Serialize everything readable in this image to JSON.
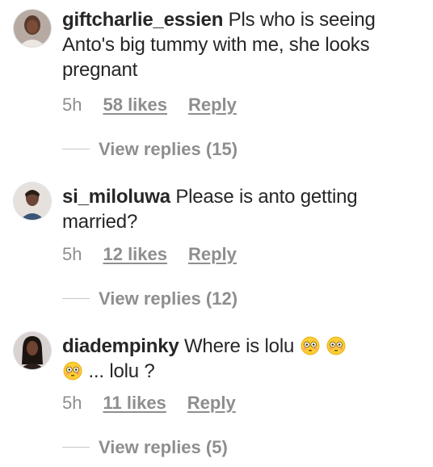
{
  "comments": [
    {
      "username": "giftcharlie_essien",
      "text": "Pls who is seeing Anto's big tummy with me, she looks pregnant",
      "time": "5h",
      "likes": "58 likes",
      "reply": "Reply",
      "view_replies": "View replies (15)"
    },
    {
      "username": "si_miloluwa",
      "text": "Please is anto getting married?",
      "time": "5h",
      "likes": "12 likes",
      "reply": "Reply",
      "view_replies": "View replies (12)"
    },
    {
      "username": "diadempinky",
      "text_before": "Where is lolu",
      "text_after": "... lolu ?",
      "time": "5h",
      "likes": "11 likes",
      "reply": "Reply",
      "view_replies": "View replies (5)"
    }
  ],
  "icons": {
    "emoji": "flushed-face-emoji"
  },
  "colors": {
    "text": "#262626",
    "muted": "#8e8e8e"
  }
}
